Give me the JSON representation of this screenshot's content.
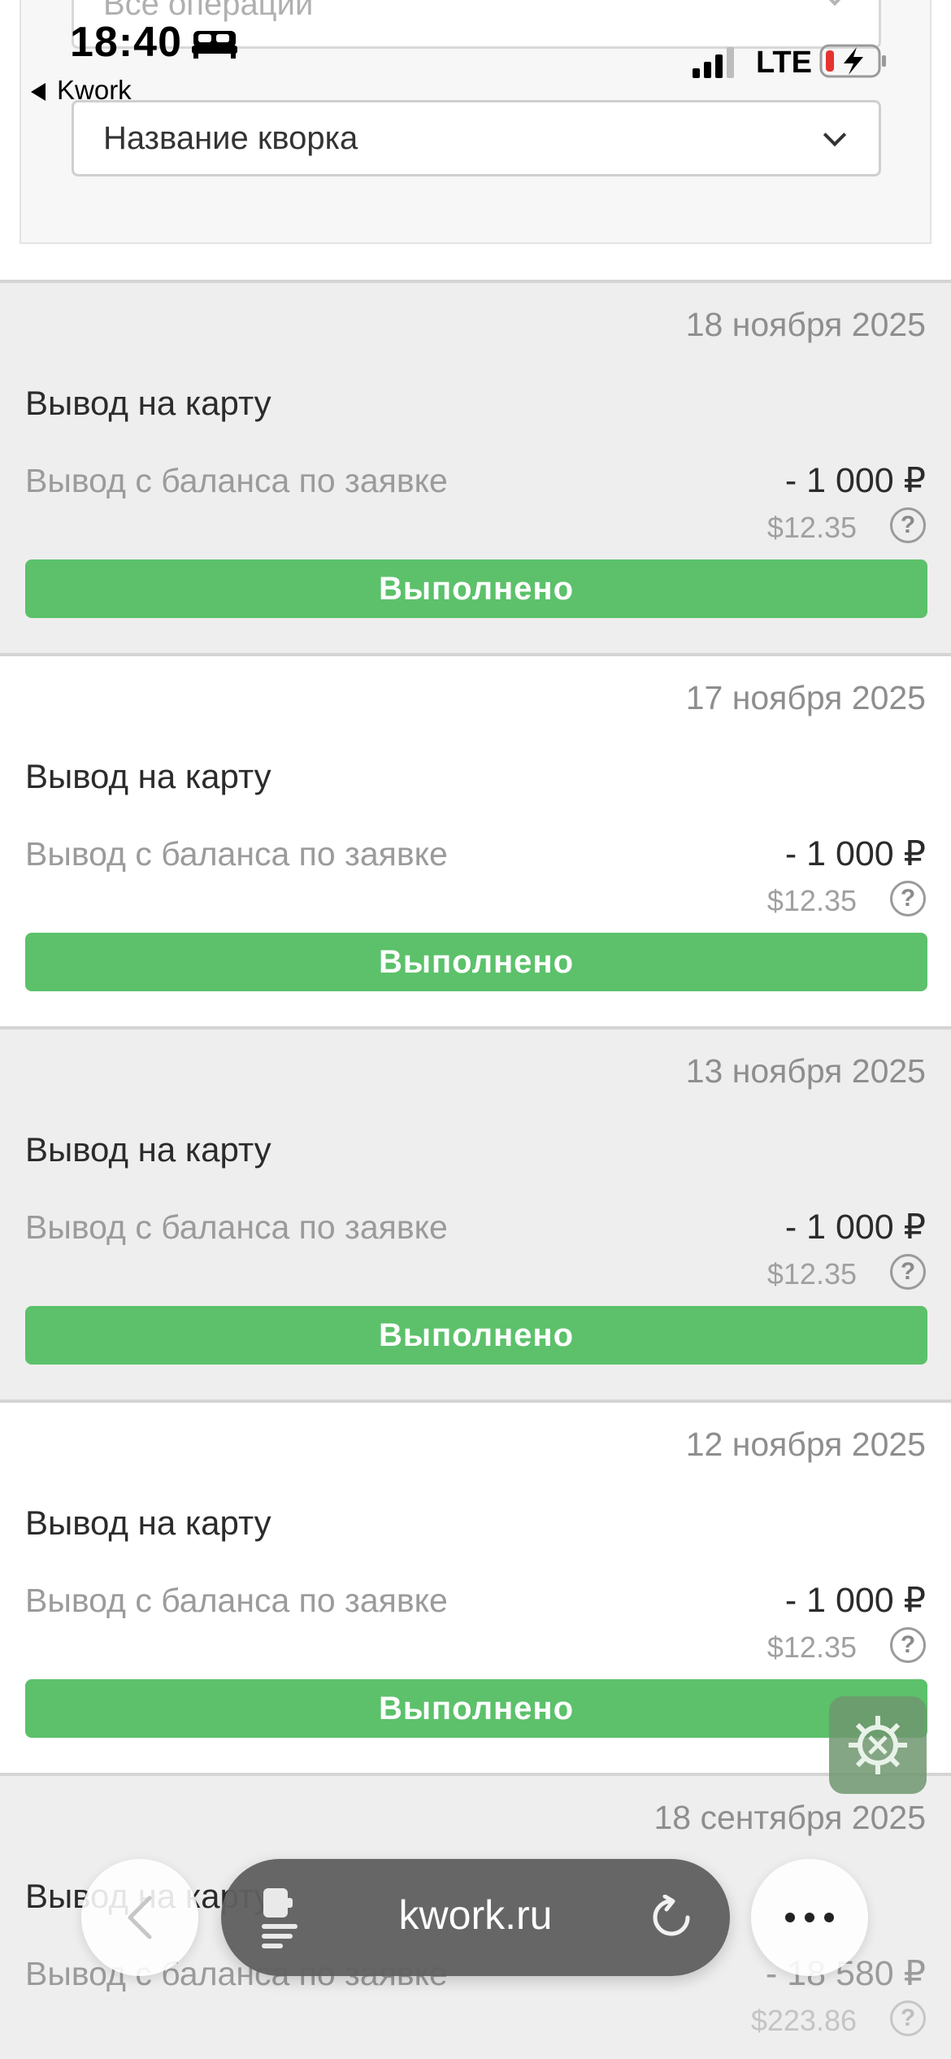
{
  "filters": {
    "operations_value": "Все операции",
    "kwork_value": "Название кворка"
  },
  "status_bar": {
    "time": "18:40",
    "back_app": "Kwork",
    "network": "LTE"
  },
  "operations": [
    {
      "date": "18 ноября 2025",
      "title": "Вывод на карту",
      "description": "Вывод с баланса по заявке",
      "amount": "- 1 000 ₽",
      "usd": "$12.35",
      "status": "Выполнено"
    },
    {
      "date": "17 ноября 2025",
      "title": "Вывод на карту",
      "description": "Вывод с баланса по заявке",
      "amount": "- 1 000 ₽",
      "usd": "$12.35",
      "status": "Выполнено"
    },
    {
      "date": "13 ноября 2025",
      "title": "Вывод на карту",
      "description": "Вывод с баланса по заявке",
      "amount": "- 1 000 ₽",
      "usd": "$12.35",
      "status": "Выполнено"
    },
    {
      "date": "12 ноября 2025",
      "title": "Вывод на карту",
      "description": "Вывод с баланса по заявке",
      "amount": "- 1 000 ₽",
      "usd": "$12.35",
      "status": "Выполнено"
    },
    {
      "date": "18 сентября 2025",
      "title": "Вывод на карту",
      "description": "Вывод с баланса по заявке",
      "amount": "- 18 580 ₽",
      "usd": "$223.86",
      "status": ""
    }
  ],
  "help_glyph": "?",
  "browser": {
    "address": "kwork.ru"
  },
  "colors": {
    "success": "#5cc16a",
    "card_alt_bg": "#eeeeee"
  },
  "icons": [
    "bed-icon",
    "signal-icon",
    "battery-charging-icon",
    "help-icon",
    "tools-gear-icon",
    "chevron-left-icon",
    "extension-icon",
    "reload-icon",
    "more-icon"
  ]
}
